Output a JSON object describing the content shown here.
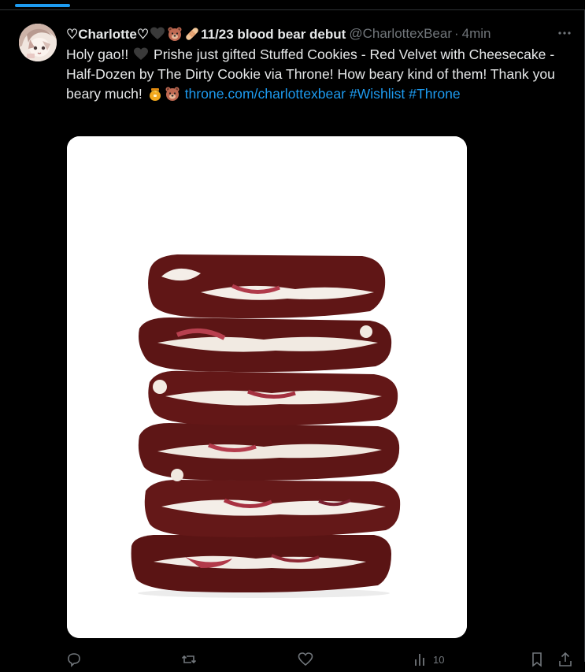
{
  "tweet": {
    "display_name_prefix": "♡Charlotte♡",
    "display_name_suffix": "11/23 blood bear debut",
    "handle": "@CharlottexBear",
    "separator": "·",
    "time": "4min",
    "text_part1": "Holy gao!! ",
    "text_part2": " Prishe just gifted Stuffed Cookies - Red Velvet with Cheesecake - Half-Dozen by The Dirty Cookie via Throne! How beary kind of them! Thank you beary much! ",
    "link": "throne.com/charlottexbear",
    "hashtags": [
      "#Wishlist",
      "#Throne"
    ],
    "views_count": "10",
    "name_emoji_icons": [
      "black-heart-icon",
      "bear-icon",
      "bandage-icon"
    ],
    "text_emoji_icons": [
      "black-heart-icon",
      "honey-pot-icon",
      "bear-icon"
    ]
  },
  "colors": {
    "background": "#000000",
    "text": "#e7e9ea",
    "secondary_text": "#71767b",
    "link": "#1d9bf0",
    "border": "#2f3336"
  },
  "media": {
    "description_icon": "red-velvet-cookie-stack-photo"
  }
}
